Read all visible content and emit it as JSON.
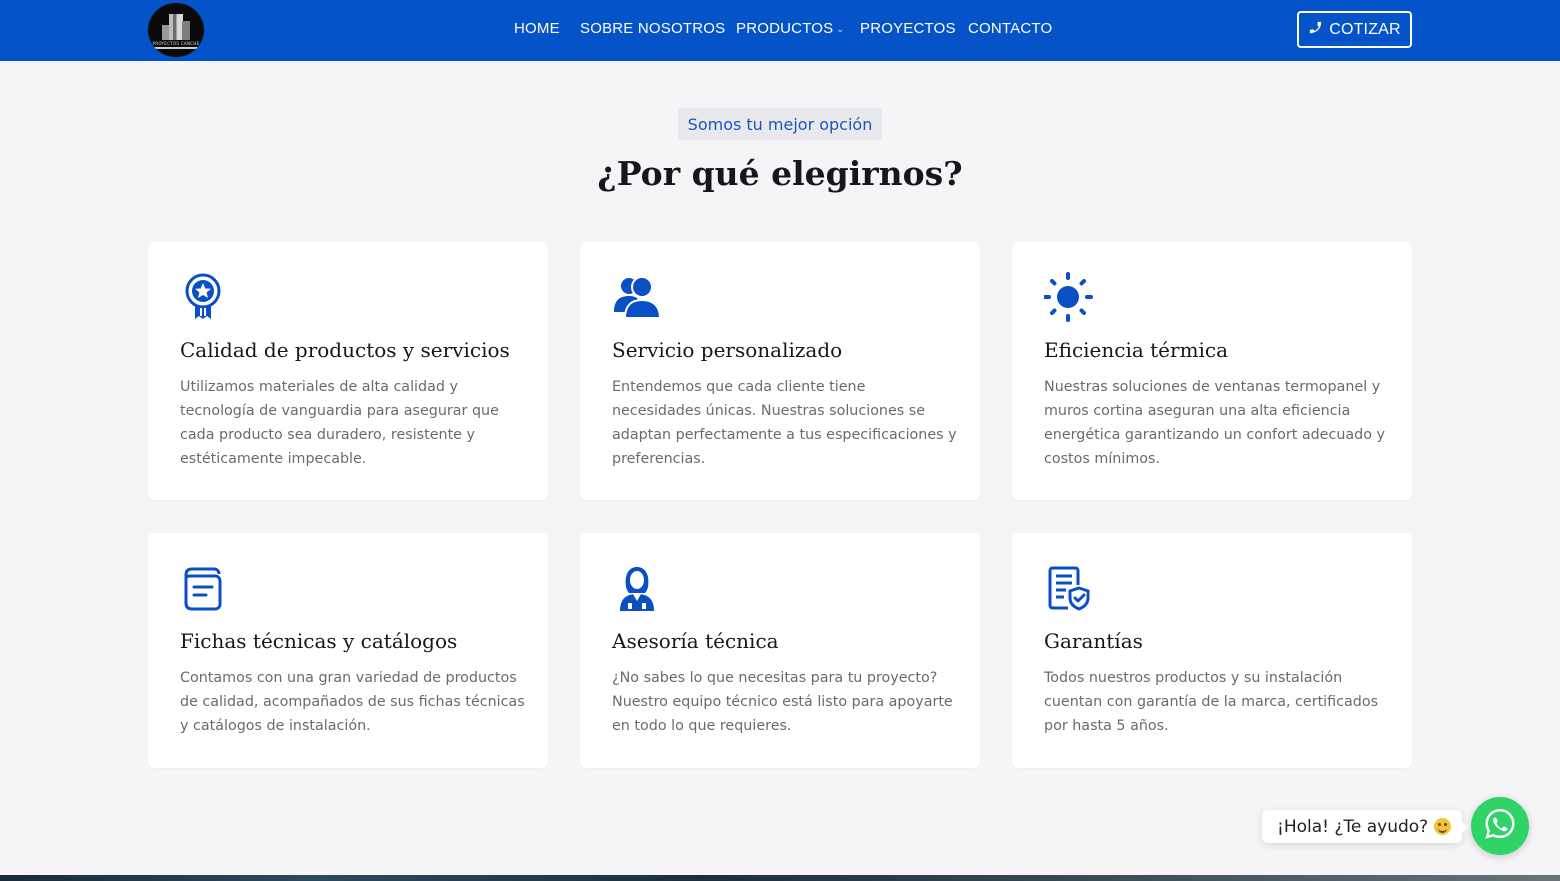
{
  "header": {
    "logo_text": "PROYECTOS CANCHE",
    "nav": [
      {
        "label": "HOME"
      },
      {
        "label": "SOBRE NOSOTROS"
      },
      {
        "label": "PRODUCTOS",
        "has_dropdown": true
      },
      {
        "label": "PROYECTOS"
      },
      {
        "label": "CONTACTO"
      }
    ],
    "cta": {
      "label": "COTIZAR",
      "icon": "phone-icon"
    },
    "background_color": "#0453c9"
  },
  "section": {
    "tagline": "Somos tu mejor opción",
    "title": "¿Por qué elegirnos?"
  },
  "features": [
    {
      "icon": "award-ribbon-icon",
      "title": "Calidad de productos y servicios",
      "description": "Utilizamos materiales de alta calidad y tecnología de vanguardia para asegurar que cada producto sea duradero, resistente y estéticamente impecable."
    },
    {
      "icon": "users-icon",
      "title": "Servicio personalizado",
      "description": "Entendemos que cada cliente tiene necesidades únicas. Nuestras soluciones se adaptan perfectamente a tus especificaciones y preferencias."
    },
    {
      "icon": "sun-icon",
      "title": "Eficiencia térmica",
      "description": "Nuestras soluciones de ventanas termopanel y muros cortina aseguran una alta eficiencia energética garantizando un confort adecuado y costos mínimos."
    },
    {
      "icon": "document-folder-icon",
      "title": "Fichas técnicas y catálogos",
      "description": "Contamos con una gran variedad de productos de calidad, acompañados de sus fichas técnicas y catálogos de instalación."
    },
    {
      "icon": "advisor-person-icon",
      "title": "Asesoría técnica",
      "description": "¿No sabes lo que necesitas para tu proyecto? Nuestro equipo técnico está listo para apoyarte en todo lo que requieres."
    },
    {
      "icon": "warranty-certificate-icon",
      "title": "Garantías",
      "description": "Todos nuestros productos y su instalación cuentan con garantía de la marca, certificados por hasta 5 años."
    }
  ],
  "whatsapp": {
    "bubble_text": "¡Hola! ¿Te ayudo?",
    "icon": "whatsapp-icon",
    "color": "#2fd366"
  },
  "colors": {
    "accent": "#0453c9",
    "icon_blue": "#0a4fc4",
    "page_bg": "#f5f4f6",
    "card_bg": "#ffffff"
  }
}
